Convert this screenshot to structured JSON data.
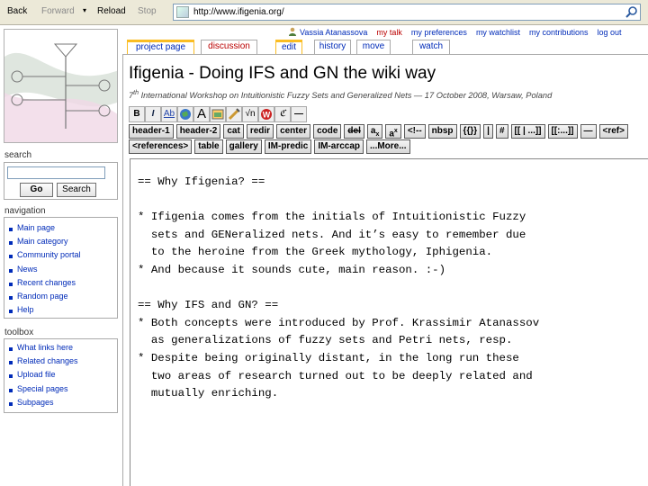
{
  "browser": {
    "back": "Back",
    "forward": "Forward",
    "forward_menu": "▾",
    "reload": "Reload",
    "stop": "Stop",
    "url": "http://www.ifigenia.org/"
  },
  "personal": {
    "user": "Vassia Atanassova",
    "talk": "my talk",
    "preferences": "my preferences",
    "watchlist": "my watchlist",
    "contributions": "my contributions",
    "logout": "log out"
  },
  "tabs": {
    "project": "project page",
    "discussion": "discussion",
    "edit": "edit",
    "history": "history",
    "move": "move",
    "watch": "watch"
  },
  "page": {
    "title": "Ifigenia - Doing IFS and GN the wiki way",
    "subtitle_sup": "th",
    "subtitle_num": "7",
    "subtitle_rest": " International Workshop on Intuitionistic Fuzzy Sets and Generalized Nets — 17 October 2008, Warsaw, Poland"
  },
  "toolbar_icons": [
    "B",
    "I",
    "Ab",
    "globe",
    "A",
    "image",
    "media",
    "√n",
    "nowiki",
    "sig",
    "—"
  ],
  "editor_buttons_row1": [
    "header-1",
    "header-2",
    "cat",
    "redir",
    "center",
    "code",
    "del",
    "a",
    "a",
    "<!--",
    "nbsp",
    "{{}}",
    "|",
    "#",
    "[[ | ...]]",
    "[[:...]]",
    "—",
    "<ref>"
  ],
  "editor_buttons_row2": [
    "<references>",
    "table",
    "gallery",
    "IM-predic",
    "IM-arccap",
    "...More..."
  ],
  "editor_text": "== Why Ifigenia? ==\n\n* Ifigenia comes from the initials of Intuitionistic Fuzzy\n  sets and GENeralized nets. And it’s easy to remember due\n  to the heroine from the Greek mythology, Iphigenia.\n* And because it sounds cute, main reason. :-)\n\n== Why IFS and GN? ==\n* Both concepts were introduced by Prof. Krassimir Atanassov\n  as generalizations of fuzzy sets and Petri nets, resp.\n* Despite being originally distant, in the long run these\n  two areas of research turned out to be deeply related and\n  mutually enriching.",
  "search": {
    "title": "search",
    "go": "Go",
    "search": "Search"
  },
  "navigation": {
    "title": "navigation",
    "items": [
      "Main page",
      "Main category",
      "Community portal",
      "News",
      "Recent changes",
      "Random page",
      "Help"
    ]
  },
  "toolbox": {
    "title": "toolbox",
    "items": [
      "What links here",
      "Related changes",
      "Upload file",
      "Special pages",
      "Subpages"
    ]
  }
}
